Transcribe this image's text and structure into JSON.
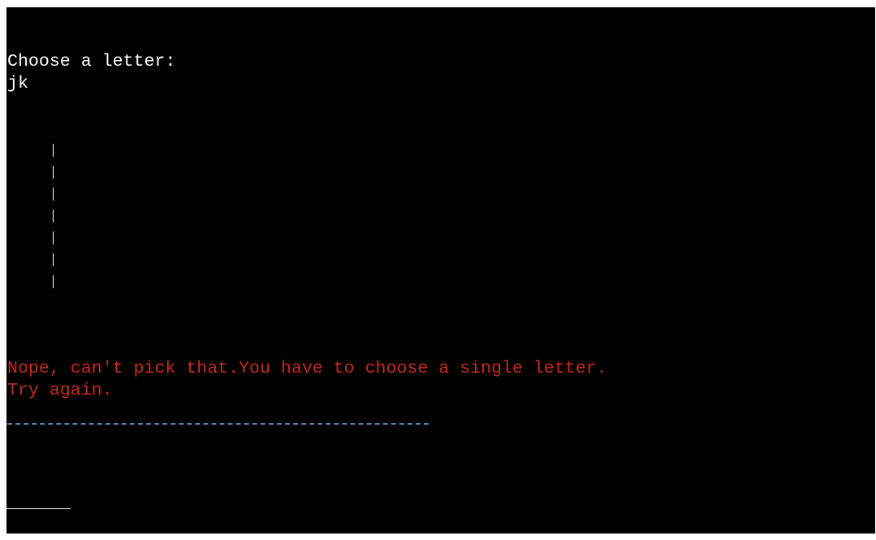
{
  "terminal": {
    "prompt": "Choose a letter:",
    "user_input": "jk",
    "error_line_1": "Nope, can't pick that.You have to choose a single letter.",
    "error_line_2": "Try again.",
    "hangman_pole_segments": 7,
    "colors": {
      "background": "#000000",
      "text": "#ffffff",
      "error": "#c42b1c",
      "divider": "#5b7fa6"
    }
  }
}
